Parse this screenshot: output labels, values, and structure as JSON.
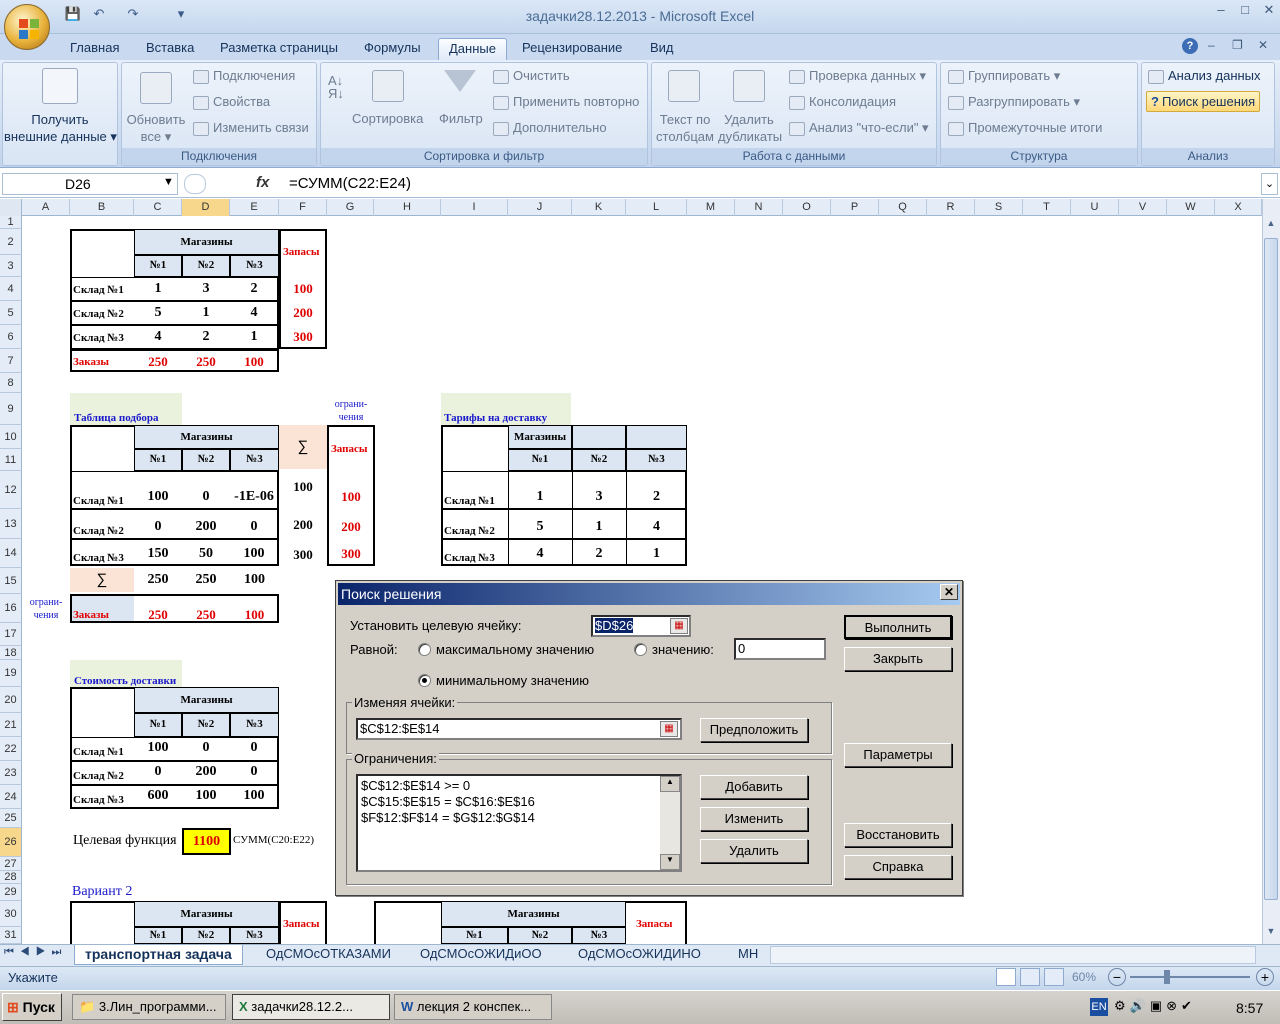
{
  "window": {
    "title": "задачки28.12.2013 - Microsoft Excel",
    "min": "–",
    "max": "□",
    "close": "✕"
  },
  "ribbon": {
    "tabs": [
      "Главная",
      "Вставка",
      "Разметка страницы",
      "Формулы",
      "Данные",
      "Рецензирование",
      "Вид"
    ],
    "active_tab": "Данные",
    "groups": {
      "get_data": {
        "label": "",
        "button": [
          "Получить",
          "внешние данные ▾"
        ]
      },
      "connections": {
        "label": "Подключения",
        "refresh": [
          "Обновить",
          "все ▾"
        ],
        "items": [
          "Подключения",
          "Свойства",
          "Изменить связи"
        ]
      },
      "sort_filter": {
        "label": "Сортировка и фильтр",
        "sort": "Сортировка",
        "filter": "Фильтр",
        "items": [
          "Очистить",
          "Применить повторно",
          "Дополнительно"
        ]
      },
      "data_tools": {
        "label": "Работа с данными",
        "text_to_cols": [
          "Текст по",
          "столбцам"
        ],
        "remove_dup": [
          "Удалить",
          "дубликаты"
        ],
        "items": [
          "Проверка данных ▾",
          "Консолидация",
          "Анализ \"что-если\" ▾"
        ]
      },
      "outline": {
        "label": "Структура",
        "items": [
          "Группировать ▾",
          "Разгруппировать ▾",
          "Промежуточные итоги"
        ]
      },
      "analysis": {
        "label": "Анализ",
        "items": [
          "Анализ данных",
          "Поиск решения"
        ]
      }
    }
  },
  "formula_bar": {
    "name_box": "D26",
    "fx": "fx",
    "formula": "=СУММ(C22:E24)"
  },
  "columns": [
    "A",
    "B",
    "C",
    "D",
    "E",
    "F",
    "G",
    "H",
    "I",
    "J",
    "K",
    "L",
    "M",
    "N",
    "O",
    "P",
    "Q",
    "R",
    "S",
    "T",
    "U",
    "V",
    "W",
    "X"
  ],
  "rows": [
    "1",
    "2",
    "3",
    "4",
    "5",
    "6",
    "7",
    "8",
    "9",
    "10",
    "11",
    "12",
    "13",
    "14",
    "15",
    "16",
    "17",
    "18",
    "19",
    "20",
    "21",
    "22",
    "23",
    "24",
    "25",
    "26",
    "27",
    "28",
    "29",
    "30",
    "31"
  ],
  "sheet": {
    "t1": {
      "shops": "Магазины",
      "stock": "Запасы",
      "cols": [
        "№1",
        "№2",
        "№3"
      ],
      "rows": [
        {
          "label": "Склад №1",
          "vals": [
            "1",
            "3",
            "2"
          ],
          "stock": "100"
        },
        {
          "label": "Склад №2",
          "vals": [
            "5",
            "1",
            "4"
          ],
          "stock": "200"
        },
        {
          "label": "Склад №3",
          "vals": [
            "4",
            "2",
            "1"
          ],
          "stock": "300"
        }
      ],
      "orders_label": "Заказы",
      "orders": [
        "250",
        "250",
        "100"
      ]
    },
    "t2": {
      "title": "Таблица подбора",
      "shops": "Магазины",
      "sigma": "∑",
      "constraints_label": "ограни-чения",
      "stock": "Запасы",
      "cols": [
        "№1",
        "№2",
        "№3"
      ],
      "rows": [
        {
          "label": "Склад №1",
          "vals": [
            "100",
            "0",
            "-1E-06"
          ],
          "sum": "100",
          "stock": "100"
        },
        {
          "label": "Склад №2",
          "vals": [
            "0",
            "200",
            "0"
          ],
          "sum": "200",
          "stock": "200"
        },
        {
          "label": "Склад №3",
          "vals": [
            "150",
            "50",
            "100"
          ],
          "sum": "300",
          "stock": "300"
        }
      ],
      "sum_row": [
        "250",
        "250",
        "100"
      ],
      "left_constraints": "ограни-чения",
      "orders_label": "Заказы",
      "orders": [
        "250",
        "250",
        "100"
      ]
    },
    "t3": {
      "title": "Тарифы на доставку",
      "shops": "Магазины",
      "cols": [
        "№1",
        "№2",
        "№3"
      ],
      "rows": [
        {
          "label": "Склад №1",
          "vals": [
            "1",
            "3",
            "2"
          ]
        },
        {
          "label": "Склад №2",
          "vals": [
            "5",
            "1",
            "4"
          ]
        },
        {
          "label": "Склад №3",
          "vals": [
            "4",
            "2",
            "1"
          ]
        }
      ]
    },
    "t4": {
      "title": "Стоимость доставки",
      "shops": "Магазины",
      "cols": [
        "№1",
        "№2",
        "№3"
      ],
      "rows": [
        {
          "label": "Склад №1",
          "vals": [
            "100",
            "0",
            "0"
          ]
        },
        {
          "label": "Склад №2",
          "vals": [
            "0",
            "200",
            "0"
          ]
        },
        {
          "label": "Склад №3",
          "vals": [
            "600",
            "100",
            "100"
          ]
        }
      ]
    },
    "objective": {
      "label": "Целевая функция",
      "value": "1100",
      "note": "СУММ(C20:E22)"
    },
    "variant2": {
      "title": "Вариант 2",
      "shops": "Магазины",
      "stock": "Запасы",
      "cols": [
        "№1",
        "№2",
        "№3"
      ]
    }
  },
  "solver": {
    "title": "Поиск решения",
    "target_label": "Установить целевую ячейку:",
    "target_value": "$D$26",
    "equal_label": "Равной:",
    "opt_max": "максимальному значению",
    "opt_value": "значению:",
    "value_field": "0",
    "opt_min": "минимальному значению",
    "selected": "min",
    "changing_label": "Изменяя ячейки:",
    "changing_value": "$C$12:$E$14",
    "constraints_label": "Ограничения:",
    "constraints": [
      "$C$12:$E$14 >= 0",
      "$C$15:$E$15 = $C$16:$E$16",
      "$F$12:$F$14 = $G$12:$G$14"
    ],
    "buttons": {
      "solve": "Выполнить",
      "close": "Закрыть",
      "guess": "Предположить",
      "options": "Параметры",
      "add": "Добавить",
      "change": "Изменить",
      "delete": "Удалить",
      "reset": "Восстановить",
      "help": "Справка"
    }
  },
  "sheet_tabs": [
    "транспортная задача",
    "ОдСМОсОТКАЗАМИ",
    "ОдСМОсОЖИДиОО",
    "ОдСМОсОЖИДИНО",
    "МН"
  ],
  "active_sheet": "транспортная задача",
  "status": {
    "mode": "Укажите",
    "zoom": "60%"
  },
  "taskbar": {
    "start": "Пуск",
    "tasks": [
      "3.Лин_программи...",
      "задачки28.12.2...",
      "лекция 2 конспек..."
    ],
    "lang": "EN",
    "clock": "8:57"
  }
}
